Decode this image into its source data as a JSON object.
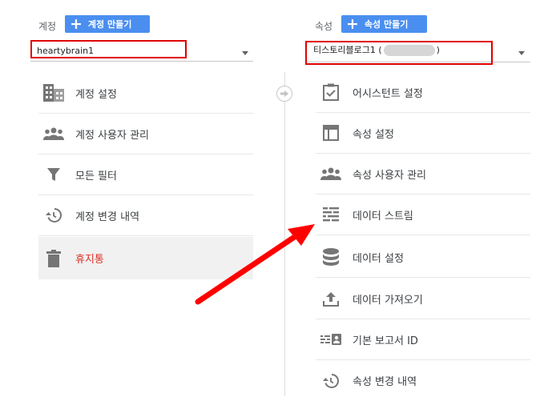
{
  "account": {
    "label": "계정",
    "create_button": "계정 만들기",
    "selected": "heartybrain1",
    "menu": [
      {
        "label": "계정 설정",
        "icon": "building-icon"
      },
      {
        "label": "계정 사용자 관리",
        "icon": "people-icon"
      },
      {
        "label": "모든 필터",
        "icon": "filter-icon"
      },
      {
        "label": "계정 변경 내역",
        "icon": "history-icon"
      },
      {
        "label": "휴지통",
        "icon": "trash-icon"
      }
    ]
  },
  "property": {
    "label": "속성",
    "create_button": "속성 만들기",
    "selected_prefix": "티스토리블로그1 (",
    "selected_suffix": ")",
    "menu": [
      {
        "label": "어시스턴트 설정",
        "icon": "clipboard-check-icon"
      },
      {
        "label": "속성 설정",
        "icon": "layout-icon"
      },
      {
        "label": "속성 사용자 관리",
        "icon": "people-icon"
      },
      {
        "label": "데이터 스트림",
        "icon": "data-stream-icon"
      },
      {
        "label": "데이터 설정",
        "icon": "database-icon"
      },
      {
        "label": "데이터 가져오기",
        "icon": "upload-icon"
      },
      {
        "label": "기본 보고서 ID",
        "icon": "report-id-icon"
      },
      {
        "label": "속성 변경 내역",
        "icon": "history-icon"
      }
    ]
  },
  "colors": {
    "accent": "#4a8ff0",
    "highlight_red": "#e00000",
    "trash_red": "#d93025"
  }
}
